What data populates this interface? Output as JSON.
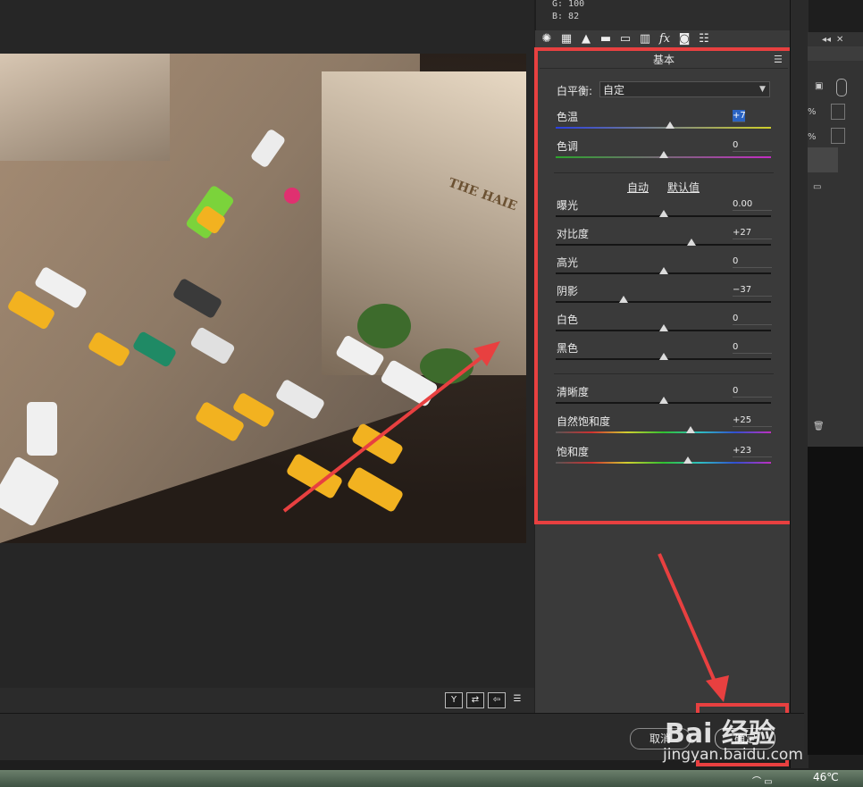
{
  "rgb_readout": {
    "g": "G:  100",
    "b": "B:   82"
  },
  "tabs": [
    "basic-tab",
    "tone-curve-tab",
    "detail-tab",
    "hsl-tab",
    "split-toning-tab",
    "lens-tab",
    "effects-tab",
    "camera-calibration-tab",
    "presets-tab"
  ],
  "panel": {
    "title": "基本",
    "white_balance_label": "白平衡:",
    "white_balance_value": "自定",
    "auto_link": "自动",
    "default_link": "默认值",
    "sliders": [
      {
        "label": "色温",
        "value": "+7",
        "fraction": 0.53,
        "style": "temp"
      },
      {
        "label": "色调",
        "value": "0",
        "fraction": 0.5,
        "style": "tint"
      },
      {
        "label": "曝光",
        "value": "0.00",
        "fraction": 0.5,
        "style": "gray"
      },
      {
        "label": "对比度",
        "value": "+27",
        "fraction": 0.63,
        "style": "gray"
      },
      {
        "label": "高光",
        "value": "0",
        "fraction": 0.5,
        "style": "gray"
      },
      {
        "label": "阴影",
        "value": "−37",
        "fraction": 0.315,
        "style": "gray"
      },
      {
        "label": "白色",
        "value": "0",
        "fraction": 0.5,
        "style": "gray"
      },
      {
        "label": "黑色",
        "value": "0",
        "fraction": 0.5,
        "style": "gray"
      },
      {
        "label": "清晰度",
        "value": "0",
        "fraction": 0.5,
        "style": "gray"
      },
      {
        "label": "自然饱和度",
        "value": "+25",
        "fraction": 0.625,
        "style": "rainbow"
      },
      {
        "label": "饱和度",
        "value": "+23",
        "fraction": 0.615,
        "style": "rainbow"
      }
    ]
  },
  "bottom": {
    "cancel": "取消",
    "ok": "确定"
  },
  "right_panel": {
    "pct1": "%",
    "pct2": "%"
  },
  "photo_sign": "THE HAIE",
  "taskbar": {
    "temperature": "46℃"
  },
  "watermark": {
    "logo": "Bai 经验",
    "url": "jingyan.baidu.com"
  },
  "colors": {
    "annotation_red": "#e84040",
    "panel_bg": "#3a3a3a"
  }
}
